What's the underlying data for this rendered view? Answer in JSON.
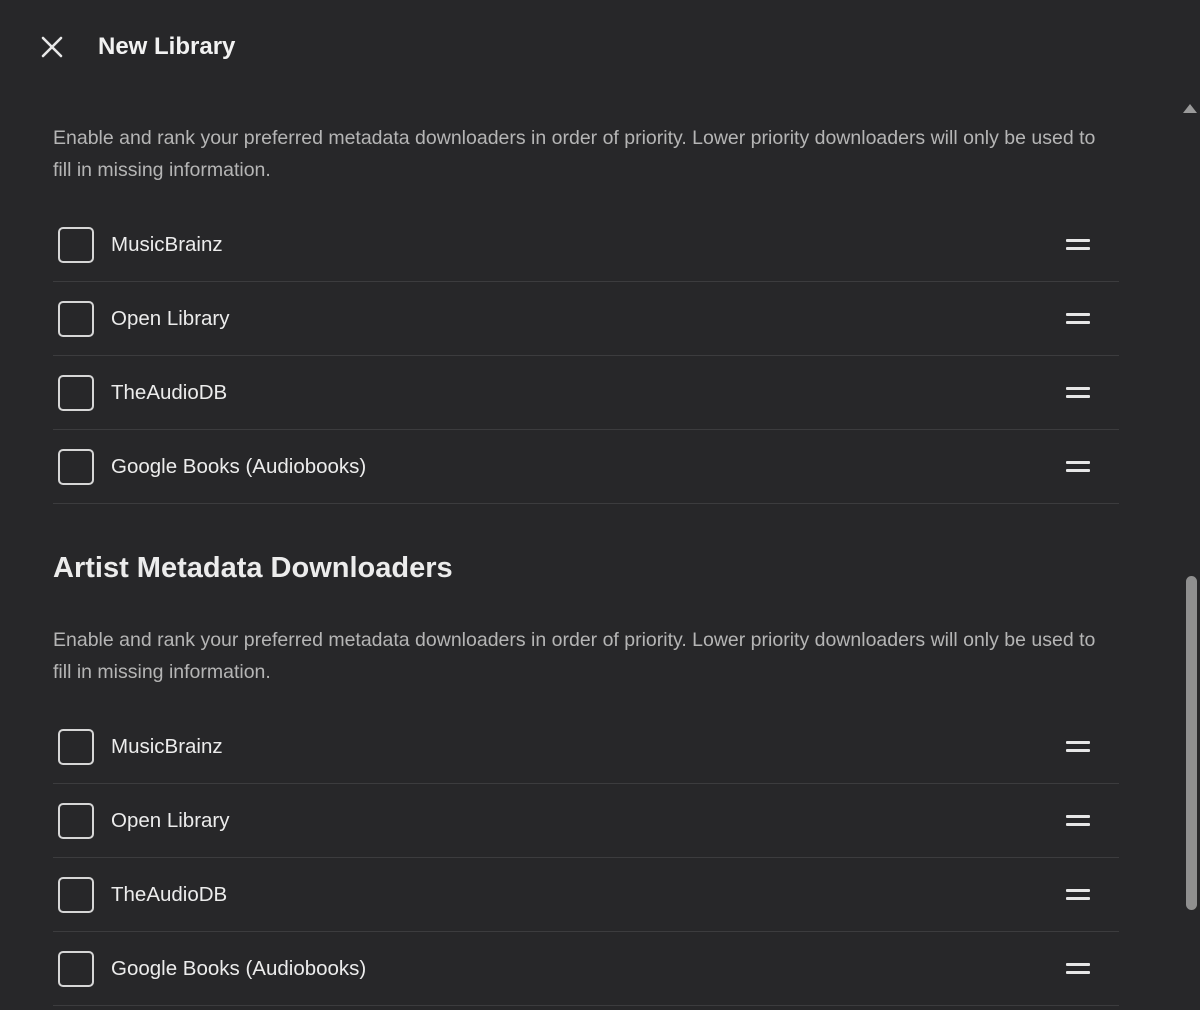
{
  "header": {
    "title": "New Library",
    "close_icon": "close-icon"
  },
  "section1": {
    "description": "Enable and rank your preferred metadata downloaders in order of priority. Lower priority downloaders will only be used to fill in missing information.",
    "items": [
      {
        "label": "MusicBrainz",
        "checked": false
      },
      {
        "label": "Open Library",
        "checked": false
      },
      {
        "label": "TheAudioDB",
        "checked": false
      },
      {
        "label": "Google Books (Audiobooks)",
        "checked": false
      }
    ]
  },
  "section2": {
    "heading": "Artist Metadata Downloaders",
    "description": "Enable and rank your preferred metadata downloaders in order of priority. Lower priority downloaders will only be used to fill in missing information.",
    "items": [
      {
        "label": "MusicBrainz",
        "checked": false
      },
      {
        "label": "Open Library",
        "checked": false
      },
      {
        "label": "TheAudioDB",
        "checked": false
      },
      {
        "label": "Google Books (Audiobooks)",
        "checked": false
      }
    ]
  },
  "colors": {
    "background": "#272729",
    "text": "#ececec",
    "muted_text": "#b5b5b5",
    "divider": "#3c3c3e",
    "scroll_thumb": "#8f8f8f"
  }
}
